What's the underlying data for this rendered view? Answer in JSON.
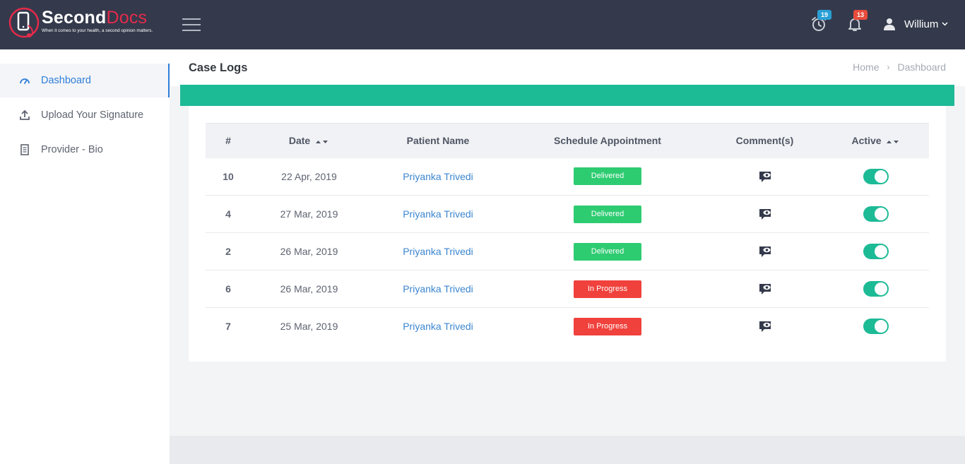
{
  "brand": {
    "name_part1": "Second",
    "name_part2": "Docs",
    "tagline": "When it comes to your health, a second opinion matters.",
    "accent_color": "#e52a4a"
  },
  "header": {
    "reminders_badge": "19",
    "reminders_badge_color": "#2a9fd6",
    "notifications_badge": "13",
    "notifications_badge_color": "#e74c3c",
    "user_name": "Willium",
    "icons": [
      "menu-icon",
      "alarm-clock-icon",
      "bell-icon",
      "user-icon",
      "chevron-down-icon"
    ]
  },
  "sidebar": {
    "items": [
      {
        "label": "Dashboard",
        "icon": "speedometer-icon",
        "active": true
      },
      {
        "label": "Upload Your Signature",
        "icon": "upload-icon",
        "active": false
      },
      {
        "label": "Provider - Bio",
        "icon": "document-icon",
        "active": false
      }
    ]
  },
  "page": {
    "title": "Case Logs",
    "breadcrumb": [
      "Home",
      "Dashboard"
    ],
    "banner_color": "#1dba96"
  },
  "table": {
    "columns": [
      "#",
      "Date",
      "Patient Name",
      "Schedule Appointment",
      "Comment(s)",
      "Active"
    ],
    "sortable_columns": [
      "Date",
      "Active"
    ],
    "rows": [
      {
        "num": "10",
        "date": "22 Apr, 2019",
        "patient": "Priyanka Trivedi",
        "status": "Delivered",
        "active": true
      },
      {
        "num": "4",
        "date": "27 Mar, 2019",
        "patient": "Priyanka Trivedi",
        "status": "Delivered",
        "active": true
      },
      {
        "num": "2",
        "date": "26 Mar, 2019",
        "patient": "Priyanka Trivedi",
        "status": "Delivered",
        "active": true
      },
      {
        "num": "6",
        "date": "26 Mar, 2019",
        "patient": "Priyanka Trivedi",
        "status": "In Progress",
        "active": true
      },
      {
        "num": "7",
        "date": "25 Mar, 2019",
        "patient": "Priyanka Trivedi",
        "status": "In Progress",
        "active": true
      }
    ],
    "status_colors": {
      "Delivered": "#2ecc71",
      "In Progress": "#f0413c"
    },
    "comment_icon": "comment-view-icon"
  }
}
